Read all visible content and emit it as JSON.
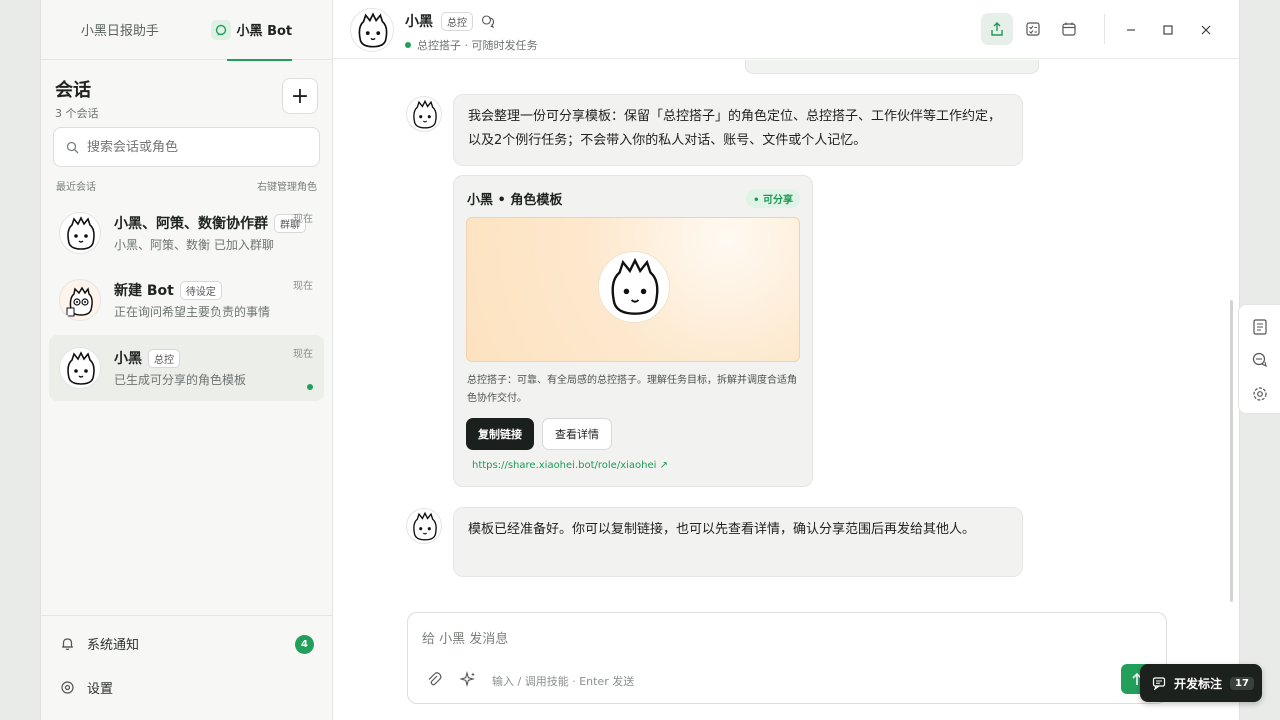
{
  "sidebar": {
    "tabs": [
      {
        "label": "小黑日报助手"
      },
      {
        "label": "小黑 Bot"
      }
    ],
    "title": "会话",
    "count": "3 个会话",
    "new_button": "+",
    "search": {
      "placeholder": "搜索会话或角色"
    },
    "section_label": "最近会话",
    "section_hint": "右键管理角色",
    "conversations": [
      {
        "name": "小黑、阿策、数衡协作群",
        "badge": "群聊",
        "preview": "小黑、阿策、数衡 已加入群聊",
        "time": "现在"
      },
      {
        "name": "新建 Bot",
        "badge": "待设定",
        "preview": "正在询问希望主要负责的事情",
        "time": "现在"
      },
      {
        "name": "小黑",
        "badge": "总控",
        "preview": "已生成可分享的角色模板",
        "time": "现在"
      }
    ],
    "notifications": {
      "label": "系统通知",
      "count": "4"
    },
    "settings": {
      "label": "设置"
    }
  },
  "header": {
    "name": "小黑",
    "badge": "总控",
    "status": "总控搭子 · 可随时发任务"
  },
  "messages": [
    {
      "text": "我会整理一份可分享模板：保留「总控搭子」的角色定位、总控搭子、工作伙伴等工作约定，以及2个例行任务；不会带入你的私人对话、账号、文件或个人记忆。"
    },
    {
      "text": "模板已经准备好。你可以复制链接，也可以先查看详情，确认分享范围后再发给其他人。"
    }
  ],
  "card": {
    "title": "小黑 • 角色模板",
    "status": "• 可分享",
    "description": "总控搭子：可靠、有全局感的总控搭子。理解任务目标，拆解并调度合适角色协作交付。",
    "copy_button": "复制链接",
    "detail_button": "查看详情",
    "link": "https://share.xiaohei.bot/role/xiaohei ↗"
  },
  "composer": {
    "placeholder": "给 小黑 发消息",
    "hint": "输入 / 调用技能 · Enter 发送"
  },
  "dev_badge": {
    "label": "开发标注",
    "count": "17"
  },
  "colors": {
    "accent": "#22a05b",
    "dark": "#1c211e"
  }
}
